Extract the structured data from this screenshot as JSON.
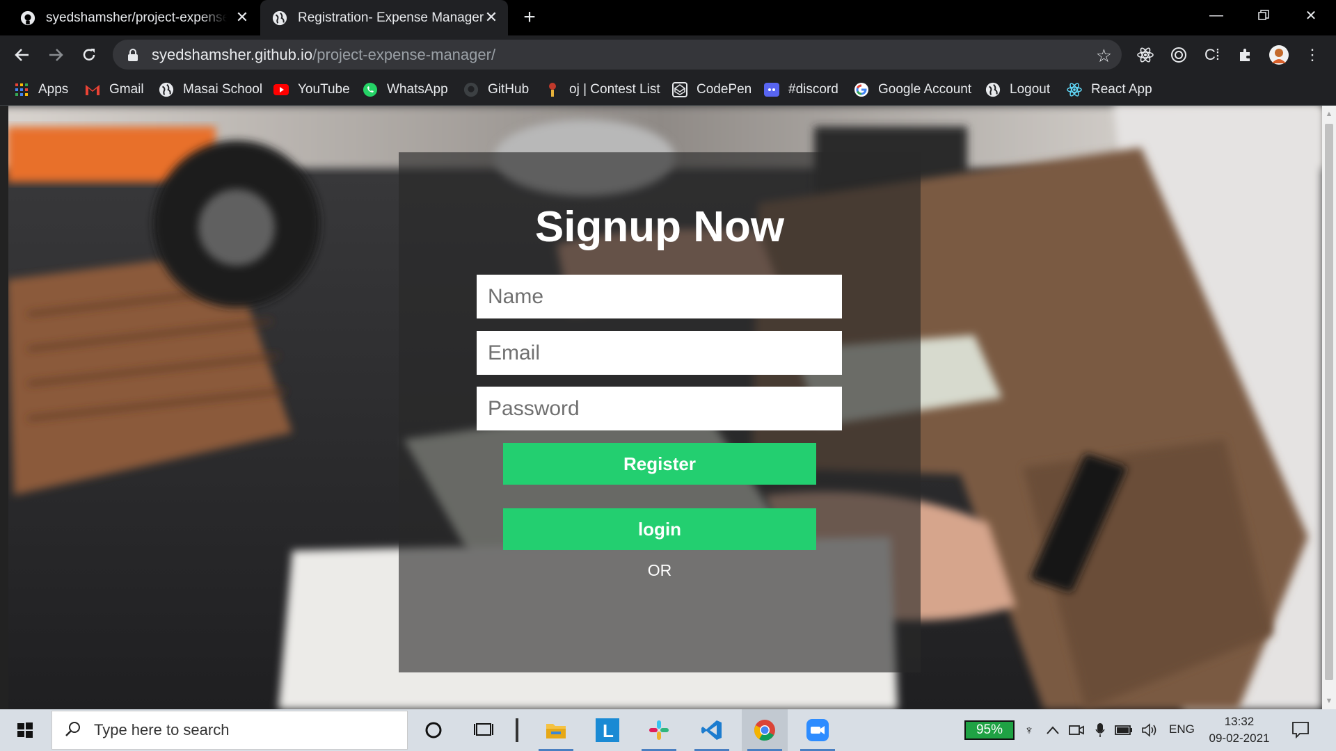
{
  "browser": {
    "tabs": [
      {
        "title": "syedshamsher/project-expense-manager",
        "icon": "github-icon"
      },
      {
        "title": "Registration- Expense Manager",
        "icon": "globe-icon",
        "active": true
      }
    ],
    "url": {
      "host": "syedshamsher.github.io",
      "path": "/project-expense-manager/"
    }
  },
  "bookmarks": [
    {
      "label": "Apps",
      "icon": "apps-grid-icon"
    },
    {
      "label": "Gmail",
      "icon": "gmail-icon"
    },
    {
      "label": "Masai School",
      "icon": "globe-icon"
    },
    {
      "label": "YouTube",
      "icon": "youtube-icon"
    },
    {
      "label": "WhatsApp",
      "icon": "whatsapp-icon"
    },
    {
      "label": "GitHub",
      "icon": "github-icon"
    },
    {
      "label": "oj | Contest List",
      "icon": "oj-icon"
    },
    {
      "label": "CodePen",
      "icon": "codepen-icon"
    },
    {
      "label": "#discord",
      "icon": "discord-icon"
    },
    {
      "label": "Google Account",
      "icon": "google-icon"
    },
    {
      "label": "Logout",
      "icon": "globe-icon"
    },
    {
      "label": "React App",
      "icon": "react-icon"
    }
  ],
  "page": {
    "heading": "Signup Now",
    "fields": {
      "name_placeholder": "Name",
      "email_placeholder": "Email",
      "password_placeholder": "Password"
    },
    "register_label": "Register",
    "or_label": "OR",
    "login_label": "login",
    "accent_color": "#23cf70"
  },
  "taskbar": {
    "search_placeholder": "Type here to search",
    "battery": "95%",
    "language": "ENG",
    "time": "13:32",
    "date": "09-02-2021"
  }
}
